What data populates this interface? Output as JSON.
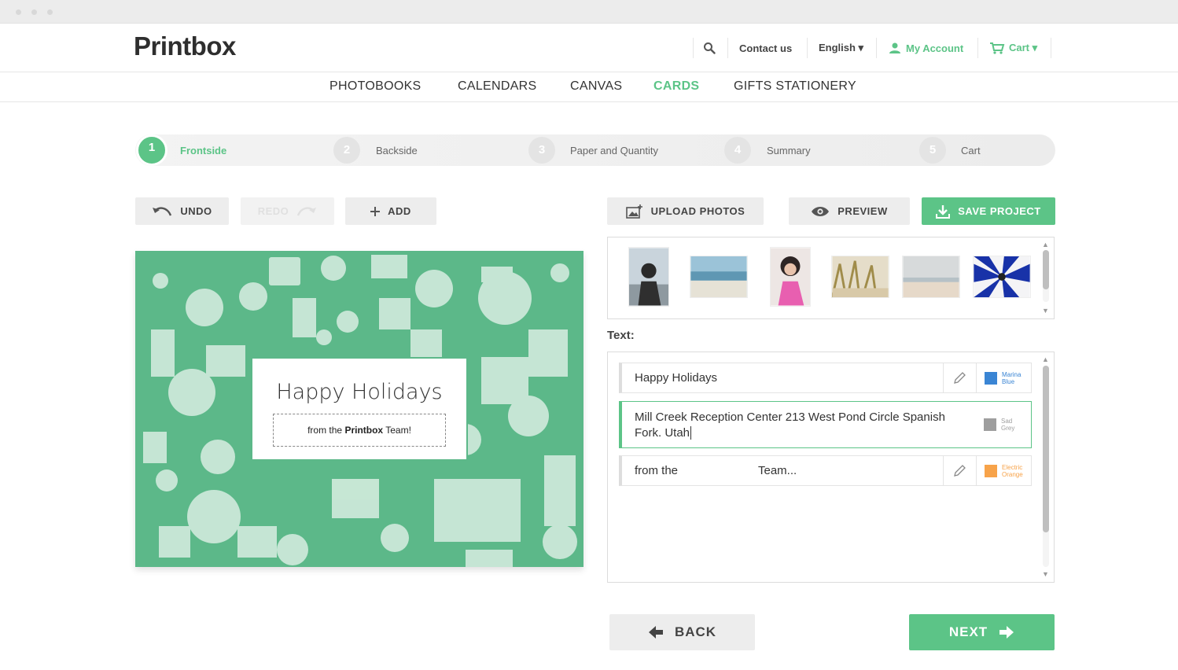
{
  "brand": {
    "name": "Printbox",
    "accent": "#5cc487"
  },
  "header": {
    "contact": "Contact us",
    "language": "English ▾",
    "account": "My Account",
    "cart": "Cart ▾"
  },
  "categories": [
    "PHOTOBOOKS",
    "CALENDARS",
    "CANVAS",
    "CARDS",
    "GIFTS STATIONERY"
  ],
  "active_category": "CARDS",
  "steps": [
    {
      "num": "1",
      "label": "Frontside",
      "active": true
    },
    {
      "num": "2",
      "label": "Backside"
    },
    {
      "num": "3",
      "label": "Paper and Quantity"
    },
    {
      "num": "4",
      "label": "Summary"
    },
    {
      "num": "5",
      "label": "Cart"
    }
  ],
  "toolbar": {
    "undo": "UNDO",
    "redo": "REDO",
    "add": "ADD",
    "upload": "UPLOAD PHOTOS",
    "preview": "PREVIEW",
    "save": "SAVE PROJECT"
  },
  "card": {
    "title": "Happy Holidays",
    "sub_prefix": "from the",
    "sub_brand": "Printbox",
    "sub_suffix": "Team!",
    "background_color": "#5cb889"
  },
  "photos": [
    {
      "name": "woman-by-sea"
    },
    {
      "name": "beach-rocks"
    },
    {
      "name": "girl-with-pigtails"
    },
    {
      "name": "dune-grass"
    },
    {
      "name": "beach-horizon"
    },
    {
      "name": "blue-umbrella"
    }
  ],
  "text_section": {
    "label": "Text:",
    "rows": [
      {
        "value": "Happy Holidays",
        "color_name_1": "Marina",
        "color_name_2": "Blue",
        "color": "#3a85d4"
      },
      {
        "value_line1": "Mill Creek Reception Center 213 West Pond Circle Spanish",
        "value_line2": "Fork. Utah",
        "color_name_1": "Sad",
        "color_name_2": "Grey",
        "color": "#9e9e9e"
      },
      {
        "value": "from the",
        "value_b": "Team...",
        "color_name_1": "Electric",
        "color_name_2": "Orange",
        "color": "#f7a34a"
      }
    ]
  },
  "footer": {
    "back": "BACK",
    "next": "NEXT"
  }
}
